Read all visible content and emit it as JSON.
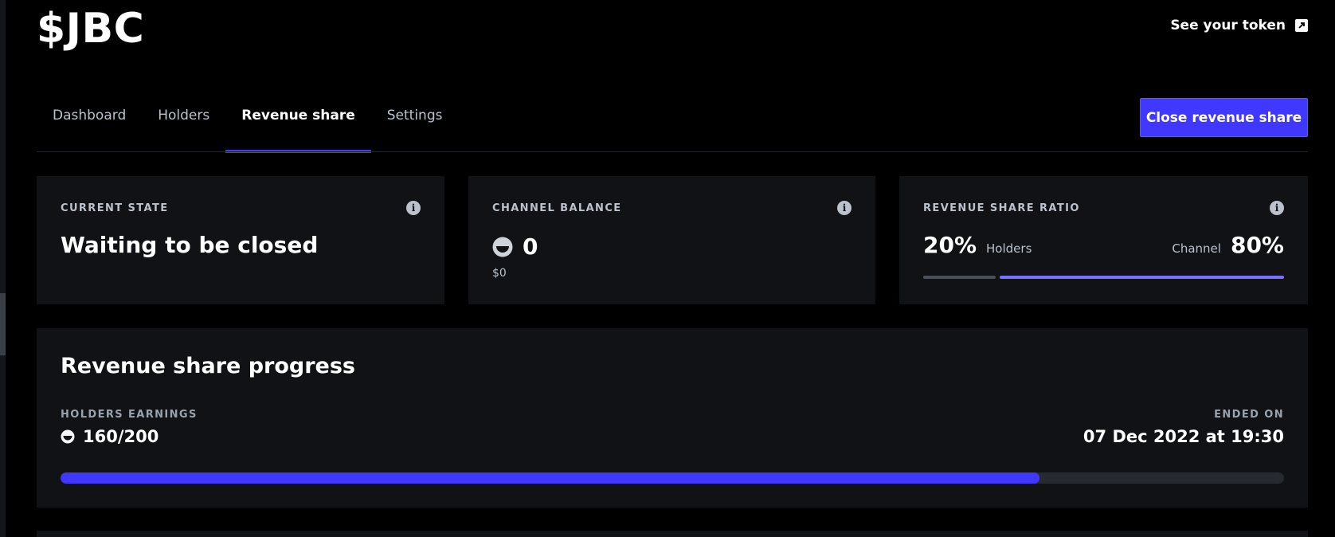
{
  "header": {
    "token_title": "$JBC",
    "see_token_label": "See your token"
  },
  "tabs": [
    {
      "label": "Dashboard",
      "active": false
    },
    {
      "label": "Holders",
      "active": false
    },
    {
      "label": "Revenue share",
      "active": true
    },
    {
      "label": "Settings",
      "active": false
    }
  ],
  "actions": {
    "close_label": "Close revenue share"
  },
  "cards": {
    "current_state": {
      "label": "CURRENT STATE",
      "value": "Waiting to be closed"
    },
    "channel_balance": {
      "label": "CHANNEL BALANCE",
      "value": "0",
      "usd": "$0"
    },
    "ratio": {
      "label": "REVENUE SHARE RATIO",
      "holders_pct": "20%",
      "holders_label": "Holders",
      "channel_label": "Channel",
      "channel_pct": "80%",
      "holders_fraction": 0.2
    }
  },
  "progress": {
    "title": "Revenue share progress",
    "earnings_label": "HOLDERS EARNINGS",
    "earnings_value": "160/200",
    "ended_label": "ENDED ON",
    "ended_value": "07 Dec 2022 at 19:30",
    "fraction": 0.8
  },
  "colors": {
    "accent": "#4038ff",
    "ratio_channel": "#7a71ff",
    "card_bg": "#101216",
    "page_bg": "#000000"
  },
  "icons": {
    "external": "external-link-icon",
    "info": "info-icon",
    "currency": "joy-token-icon"
  }
}
